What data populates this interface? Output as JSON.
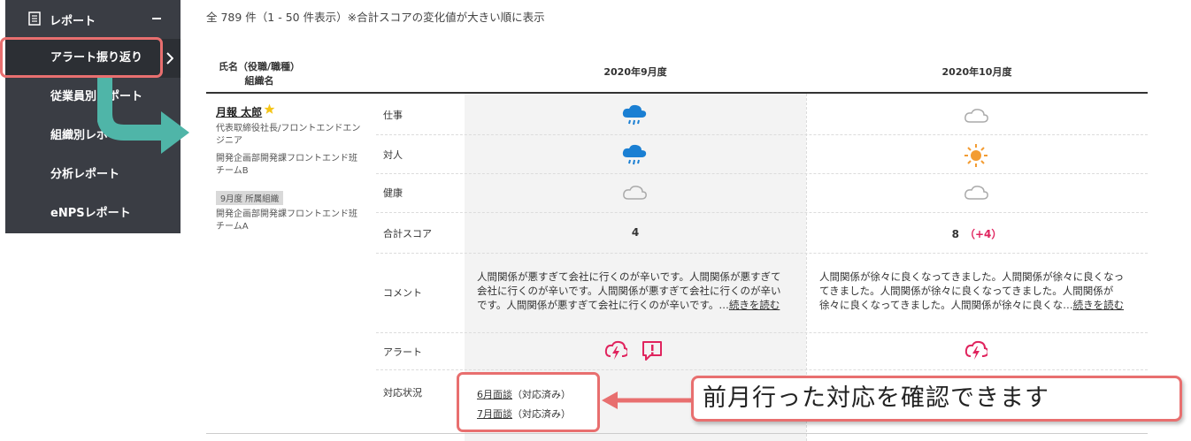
{
  "sidebar": {
    "header": "レポート",
    "items": [
      {
        "label": "アラート振り返り"
      },
      {
        "label": "従業員別レポート"
      },
      {
        "label": "組織別レポート"
      },
      {
        "label": "分析レポート"
      },
      {
        "label": "eNPSレポート"
      }
    ]
  },
  "summary": "全 789 件（1 - 50 件表示）※合計スコアの変化値が大きい順に表示",
  "table": {
    "header_name_line1": "氏名（役職/職種）",
    "header_name_line2": "組織名",
    "months": [
      "2020年9月度",
      "2020年10月度"
    ]
  },
  "employee": {
    "name": "月報 太郎",
    "title_line1": "代表取締役社長/フロントエンドエン",
    "title_line2": "ジニア",
    "org_line1": "開発企画部開発課フロントエンド班",
    "org_line2": "チームB",
    "badge": "9月度 所属組織",
    "prev_org_line1": "開発企画部開発課フロントエンド班",
    "prev_org_line2": "チームA"
  },
  "rows": {
    "work": "仕事",
    "relations": "対人",
    "health": "健康",
    "total": "合計スコア",
    "comment": "コメント",
    "alert": "アラート",
    "response": "対応状況"
  },
  "sep": {
    "score": "4",
    "comment_line1": "人間関係が悪すぎて会社に行くのが辛いです。人間関係が悪すぎて",
    "comment_line2": "会社に行くのが辛いです。人間関係が悪すぎて会社に行くのが辛い",
    "comment_line3": "です。人間関係が悪すぎて会社に行くのが辛いです。…",
    "read_more": "続きを読む",
    "response1_link": "6月面談",
    "response1_status": "（対応済み）",
    "response2_link": "7月面談",
    "response2_status": "（対応済み）"
  },
  "oct": {
    "score": "8",
    "delta": "（+4）",
    "comment_line1": "人間関係が徐々に良くなってきました。人間関係が徐々に良くなっ",
    "comment_line2": "てきました。人間関係が徐々に良くなってきました。人間関係が",
    "comment_line3": "徐々に良くなってきました。人間関係が徐々に良くな…",
    "read_more": "続きを読む"
  },
  "callout": "前月行った対応を確認できます",
  "colors": {
    "sidebar_bg": "#3a3d44",
    "highlight": "#e86f6f",
    "rain_icon": "#1a7fd3",
    "sun_icon": "#f39c32",
    "alert_icon": "#e0245e",
    "teal_arrow": "#4fb5a8"
  },
  "icons": {
    "work_sep": "rain-cloud-icon",
    "work_oct": "cloud-icon",
    "relations_sep": "rain-cloud-icon",
    "relations_oct": "sun-icon",
    "health_sep": "cloud-icon",
    "health_oct": "cloud-icon",
    "alert_sep": [
      "lightning-alert-icon",
      "exclamation-alert-icon"
    ],
    "alert_oct": [
      "lightning-alert-icon"
    ]
  }
}
